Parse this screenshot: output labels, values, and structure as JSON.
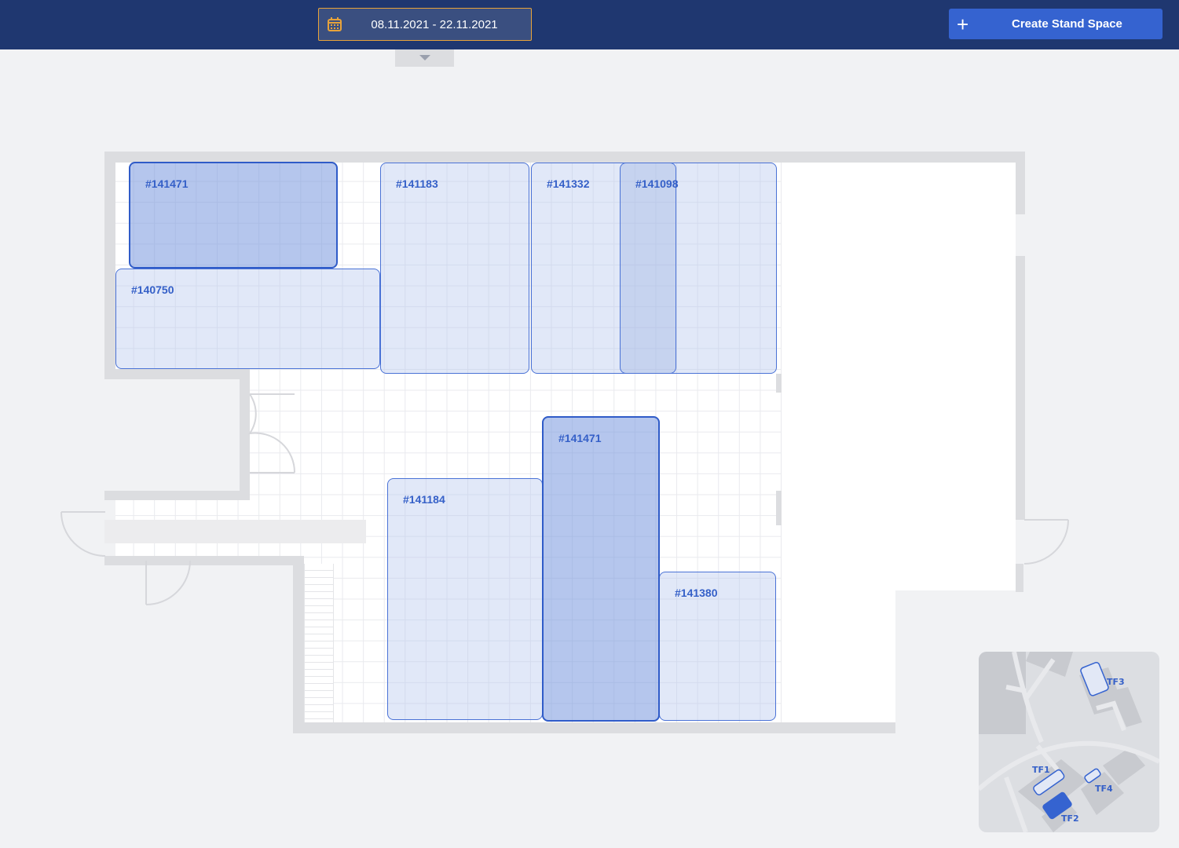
{
  "header": {
    "date_range": "08.11.2021 - 22.11.2021",
    "create_label": "Create Stand Space"
  },
  "colors": {
    "header": "#1f3770",
    "accent": "#3563d0",
    "date_border": "#e8a33a"
  },
  "stands": [
    {
      "id": "#141471",
      "selected": true
    },
    {
      "id": "#140750",
      "selected": false
    },
    {
      "id": "#141183",
      "selected": false
    },
    {
      "id": "#141332",
      "selected": false
    },
    {
      "id": "#141098",
      "selected": false
    },
    {
      "id": "#141471",
      "selected": true
    },
    {
      "id": "#141184",
      "selected": false
    },
    {
      "id": "#141380",
      "selected": false
    }
  ],
  "minimap": {
    "halls": [
      "TF1",
      "TF2",
      "TF3",
      "TF4"
    ],
    "active": "TF2"
  }
}
